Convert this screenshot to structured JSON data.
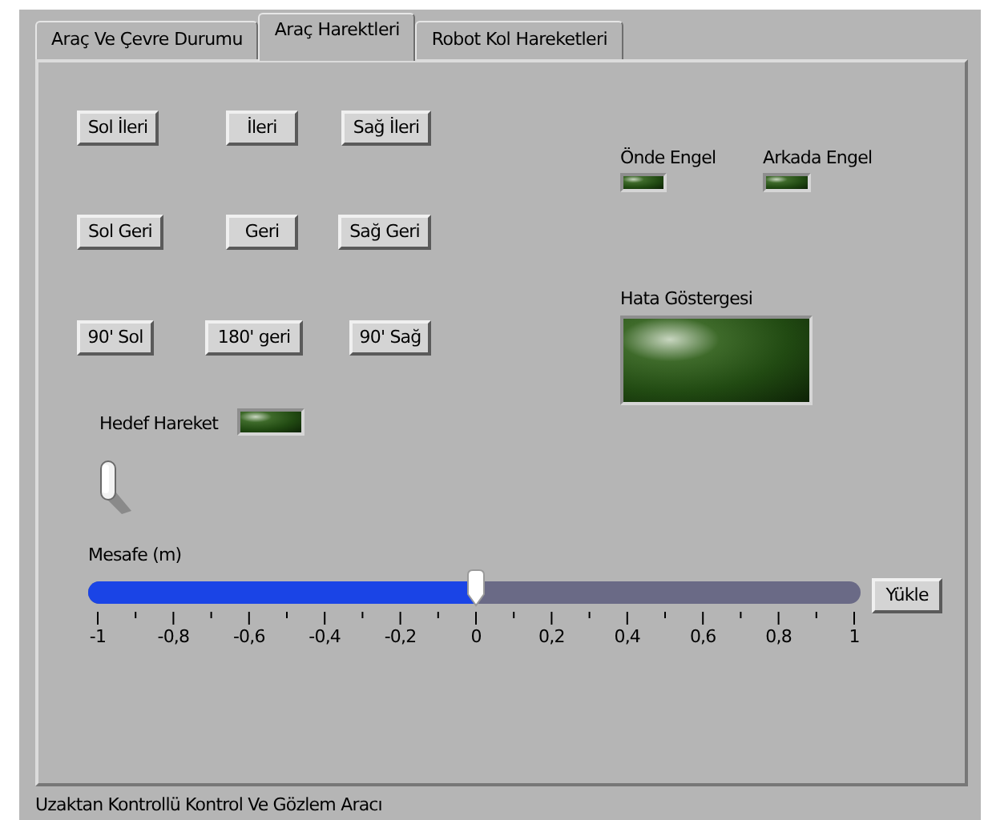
{
  "tabs": [
    {
      "label": "Araç Ve Çevre Durumu",
      "selected": false
    },
    {
      "label": "Araç Harektleri",
      "selected": true
    },
    {
      "label": "Robot Kol Hareketleri",
      "selected": false
    }
  ],
  "buttons": [
    {
      "label": "Sol İleri"
    },
    {
      "label": "İleri"
    },
    {
      "label": "Sağ İleri"
    },
    {
      "label": "Sol Geri"
    },
    {
      "label": "Geri"
    },
    {
      "label": "Sağ Geri"
    },
    {
      "label": "90' Sol"
    },
    {
      "label": "180' geri"
    },
    {
      "label": "90' Sağ"
    }
  ],
  "indicators": [
    {
      "label": "Önde Engel",
      "on": false
    },
    {
      "label": "Arkada Engel",
      "on": false
    },
    {
      "label": "Hata Göstergesi",
      "on": false
    },
    {
      "label": "Hedef Hareket",
      "on": false
    }
  ],
  "toggle": {
    "on": true
  },
  "slider": {
    "label": "Mesafe (m)",
    "level": 0.5,
    "scale": [
      "-1",
      "-0,8",
      "-0,6",
      "-0,4",
      "-0,2",
      "0",
      "0,2",
      "0,4",
      "0,6",
      "0,8",
      "1"
    ]
  },
  "load_button": {
    "label": "Yükle"
  },
  "caption": "Uzaktan Kontrollü Kontrol Ve Gözlem Aracı"
}
